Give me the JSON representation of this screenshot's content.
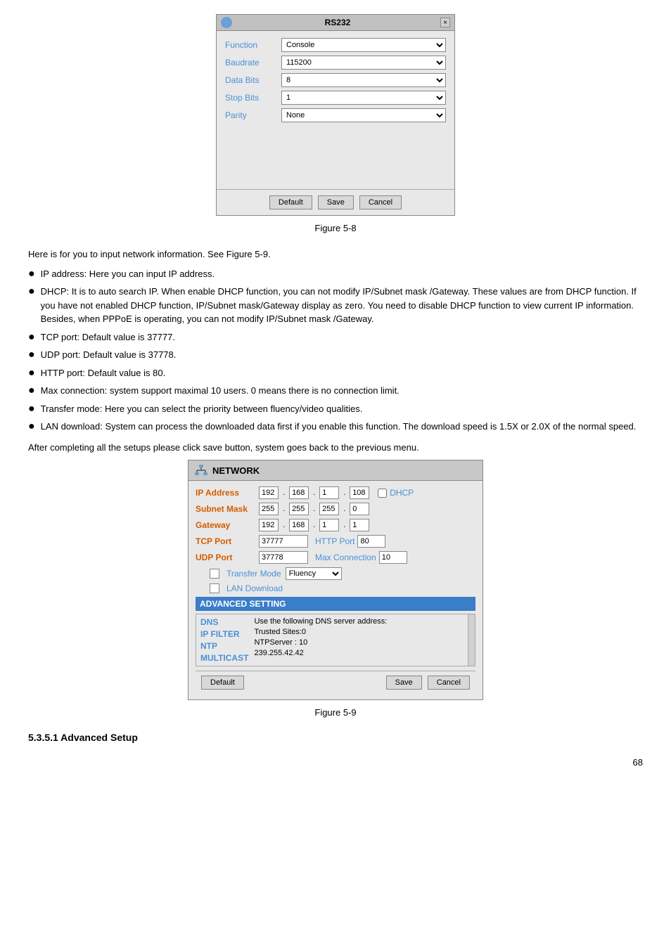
{
  "rs232_dialog": {
    "title": "RS232",
    "fields": [
      {
        "label": "Function",
        "value": "Console"
      },
      {
        "label": "Baudrate",
        "value": "115200"
      },
      {
        "label": "Data Bits",
        "value": "8"
      },
      {
        "label": "Stop Bits",
        "value": "1"
      },
      {
        "label": "Parity",
        "value": "None"
      }
    ],
    "buttons": {
      "default": "Default",
      "save": "Save",
      "cancel": "Cancel"
    }
  },
  "figure1_caption": "Figure 5-8",
  "intro_text": "Here is for you to input network information. See Figure 5-9.",
  "bullet_items": [
    "IP address: Here you can input IP address.",
    "DHCP: It is to auto search IP. When enable DHCP function, you can not modify IP/Subnet mask /Gateway. These values are from DHCP function. If you have not enabled DHCP function, IP/Subnet mask/Gateway display as zero. You need to disable DHCP function to view current IP information.  Besides, when PPPoE is operating, you can not modify IP/Subnet mask /Gateway.",
    "TCP port: Default value is 37777.",
    "UDP port: Default value is 37778.",
    "HTTP port: Default value is 80.",
    "Max connection: system support maximal 10 users. 0 means there is no connection limit.",
    "Transfer mode: Here you can select the priority between fluency/video qualities.",
    "LAN download: System can process the downloaded data first if you enable this function. The download speed is 1.5X or 2.0X of the normal speed."
  ],
  "after_text": "After completing all the setups please click save button, system goes back to the previous menu.",
  "network_dialog": {
    "title": "NETWORK",
    "ip_address": {
      "label": "IP Address",
      "octets": [
        "192",
        "168",
        "1",
        "108"
      ],
      "dhcp_label": "DHCP"
    },
    "subnet_mask": {
      "label": "Subnet Mask",
      "octets": [
        "255",
        "255",
        "255",
        "0"
      ]
    },
    "gateway": {
      "label": "Gateway",
      "octets": [
        "192",
        "168",
        "1",
        "1"
      ]
    },
    "tcp_port": {
      "label": "TCP Port",
      "value": "37777",
      "http_label": "HTTP Port",
      "http_value": "80"
    },
    "udp_port": {
      "label": "UDP Port",
      "value": "37778",
      "max_conn_label": "Max Connection",
      "max_conn_value": "10"
    },
    "transfer_mode": {
      "label": "Transfer Mode",
      "value": "Fluency"
    },
    "lan_download": {
      "label": "LAN Download"
    },
    "advanced_setting": "ADVANCED SETTING",
    "advanced_items": [
      {
        "key": "DNS",
        "value": "Use the following DNS server address:"
      },
      {
        "key": "IP FILTER",
        "value": "Trusted Sites:0"
      },
      {
        "key": "NTP",
        "value": "NTPServer : 10"
      },
      {
        "key": "MULTICAST",
        "value": "239.255.42.42"
      }
    ],
    "buttons": {
      "default": "Default",
      "save": "Save",
      "cancel": "Cancel"
    }
  },
  "figure2_caption": "Figure 5-9",
  "section_heading": "5.3.5.1  Advanced Setup",
  "page_number": "68"
}
